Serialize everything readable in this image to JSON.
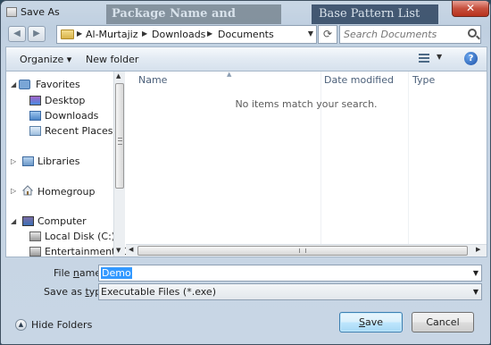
{
  "window": {
    "title": "Save As",
    "close_glyph": "✕",
    "background_titles": [
      "Package Name and Options",
      "Base Pattern List"
    ]
  },
  "navigation": {
    "back_glyph": "◀",
    "forward_glyph": "▶",
    "breadcrumb": [
      "Al-Murtajiz",
      "Downloads",
      "Documents"
    ],
    "search_placeholder": "Search Documents",
    "refresh_glyph": "⟳"
  },
  "toolbar": {
    "organize_label": "Organize ▾",
    "new_folder_label": "New folder",
    "help_glyph": "?"
  },
  "sidebar": {
    "favorites": {
      "label": "Favorites",
      "items": [
        "Desktop",
        "Downloads",
        "Recent Places"
      ]
    },
    "libraries": {
      "label": "Libraries"
    },
    "homegroup": {
      "label": "Homegroup"
    },
    "computer": {
      "label": "Computer",
      "items": [
        "Local Disk (C:)",
        "Entertainment (D"
      ]
    }
  },
  "file_list": {
    "columns": [
      "Name",
      "Date modified",
      "Type"
    ],
    "empty_message": "No items match your search."
  },
  "form": {
    "file_name_label_pre": "File ",
    "file_name_label_u": "n",
    "file_name_label_post": "ame:",
    "file_name_value": "Demo",
    "save_type_label_pre": "Save as ",
    "save_type_label_u": "t",
    "save_type_label_post": "ype:",
    "save_type_value": "Executable Files (*.exe)"
  },
  "footer": {
    "hide_folders_label": "Hide Folders",
    "save_label_u": "S",
    "save_label_post": "ave",
    "cancel_label": "Cancel"
  },
  "colors": {
    "accent": "#3399ff",
    "window_frame": "#c4d3e3",
    "close_button": "#c6503d"
  }
}
